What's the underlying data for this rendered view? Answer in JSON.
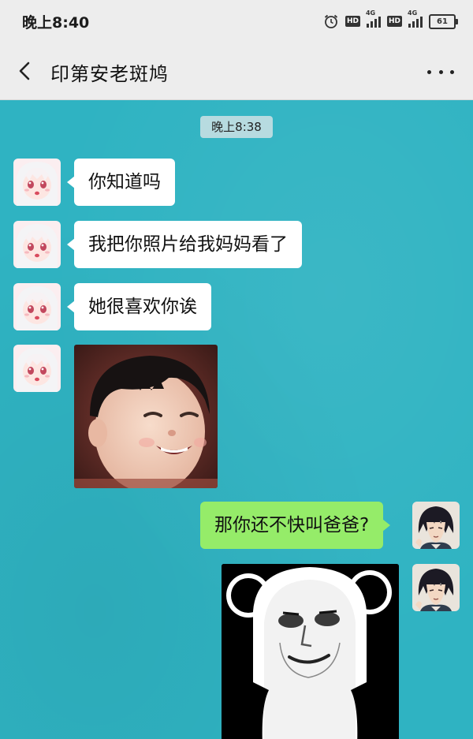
{
  "status_bar": {
    "time": "晚上8:40",
    "hd_label": "HD",
    "network_label": "4G",
    "battery": "61"
  },
  "header": {
    "title": "印第安老斑鸠",
    "back_icon": "chevron-left-icon",
    "more_icon": "more-dots-icon"
  },
  "chat": {
    "timestamp": "晚上8:38",
    "messages": [
      {
        "side": "left",
        "type": "text",
        "text": "你知道吗"
      },
      {
        "side": "left",
        "type": "text",
        "text": "我把你照片给我妈妈看了"
      },
      {
        "side": "left",
        "type": "text",
        "text": "她很喜欢你诶"
      },
      {
        "side": "left",
        "type": "image",
        "image": "smiling-child-photo"
      },
      {
        "side": "right",
        "type": "text",
        "text": "那你还不快叫爸爸?"
      },
      {
        "side": "right",
        "type": "image",
        "image": "panda-meme-sticker"
      }
    ]
  },
  "colors": {
    "chat_background": "#2fb3c2",
    "bar_background": "#ededed",
    "incoming_bubble": "#ffffff",
    "outgoing_bubble": "#95ec69"
  }
}
